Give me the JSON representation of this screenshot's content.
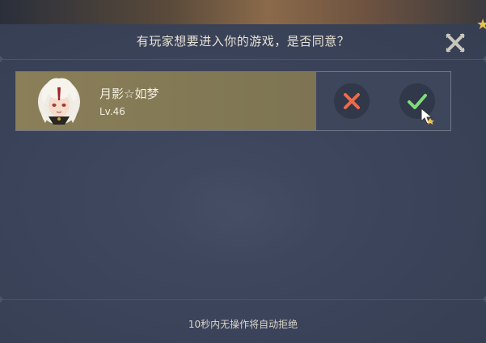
{
  "dialog": {
    "title": "有玩家想要进入你的游戏，是否同意？",
    "close_icon": "close-x-icon",
    "footer_note": "10秒内无操作将自动拒绝"
  },
  "request": {
    "player_name": "月影☆如梦",
    "player_level": "Lv.46",
    "reject_icon": "cross-icon",
    "accept_icon": "check-icon"
  },
  "colors": {
    "panel_bg": "#3b435a",
    "card_bg": "#8a7f58",
    "reject": "#ee6a4a",
    "accept": "#7fdc7a",
    "title_text": "#e8e3d6"
  }
}
